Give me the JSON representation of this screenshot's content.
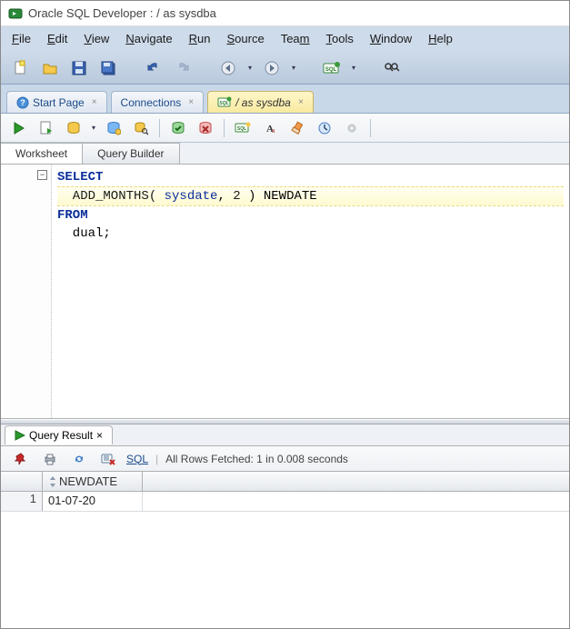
{
  "titlebar": {
    "text": "Oracle SQL Developer : / as sysdba"
  },
  "menus": {
    "file": "File",
    "edit": "Edit",
    "view": "View",
    "navigate": "Navigate",
    "run": "Run",
    "source": "Source",
    "team": "Team",
    "tools": "Tools",
    "window": "Window",
    "help": "Help"
  },
  "tabs": {
    "start": "Start Page",
    "connections": "Connections",
    "active": "/ as sysdba"
  },
  "worksheet_tabs": {
    "worksheet": "Worksheet",
    "query_builder": "Query Builder"
  },
  "sql": {
    "line1": "SELECT",
    "line2_pre": "  ADD_MONTHS( ",
    "line2_arg1": "sysdate",
    "line2_mid": ", ",
    "line2_arg2": "2",
    "line2_post": " ) NEWDATE",
    "line3": "FROM",
    "line4": "  dual;"
  },
  "result": {
    "tab_label": "Query Result",
    "sql_link": "SQL",
    "status": "All Rows Fetched: 1 in 0.008 seconds",
    "column": "NEWDATE",
    "rownum": "1",
    "value": "01-07-20"
  }
}
